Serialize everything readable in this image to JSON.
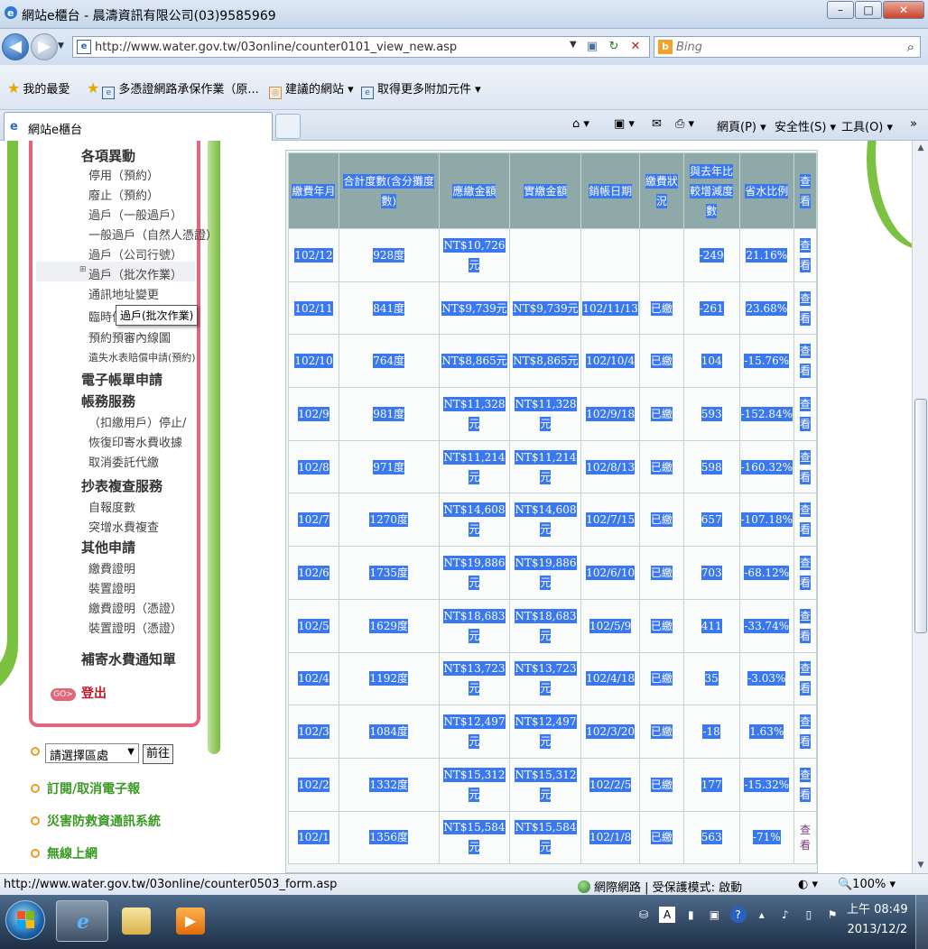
{
  "window": {
    "title": "網站e櫃台 - 晨濤資訊有限公司(03)9585969",
    "min": "–",
    "max": "□",
    "close": "✕"
  },
  "address": {
    "url": "http://www.water.gov.tw/03online/counter0101_view_new.asp",
    "back": "◀",
    "forward": "▶",
    "dropdown": "▼",
    "stop": "✕",
    "refresh": "↻",
    "compat": "▣",
    "search_placeholder": "Bing",
    "search_icon": "⌕",
    "bing_logo": "b"
  },
  "favorites": {
    "label": "我的最愛",
    "items": [
      "多憑證網路承保作業（原...",
      "建議的網站 ▾",
      "取得更多附加元件 ▾"
    ]
  },
  "tab": {
    "label": "網站e櫃台",
    "icon": "e"
  },
  "commands": {
    "home": "⌂ ▾",
    "feeds": "▣ ▾",
    "mail": "✉",
    "print": "⎙ ▾",
    "page": "網頁(P) ▾",
    "safety": "安全性(S) ▾",
    "tools": "工具(O) ▾",
    "more": "»"
  },
  "menu": {
    "sections": [
      {
        "head": "各項異動",
        "items": [
          "停用（預約）",
          "廢止（預約）",
          "過戶（一般過戶）",
          "一般過戶（自然人憑證）",
          "過戶（公司行號）",
          "過戶（批次作業）",
          "通訊地址變更",
          "臨時停",
          "預約預審內線圖",
          "遺失水表賠償申請(預約)"
        ]
      },
      {
        "head": "電子帳單申請",
        "items": []
      },
      {
        "head": "帳務服務",
        "items": [
          "（扣繳用戶）停止/",
          "恢復印寄水費收據",
          "取消委託代繳"
        ]
      },
      {
        "head": "抄表複查服務",
        "items": [
          "自報度數",
          "突增水費複查"
        ]
      },
      {
        "head": "其他申請",
        "items": [
          "繳費證明",
          "裝置證明",
          "繳費證明（憑證）",
          "裝置證明（憑證）"
        ]
      },
      {
        "head": "補寄水費通知單",
        "items": []
      }
    ],
    "logout_badge": "GO>",
    "logout": "登出",
    "bullet_marker": "⊞",
    "tooltip": "過戶(批次作業)"
  },
  "region": {
    "select_value": "請選擇區處",
    "go": "前往",
    "arrow": "▼"
  },
  "links": [
    "訂閱/取消電子報",
    "災害防救資通訊系統",
    "無線上網"
  ],
  "table": {
    "headers": [
      "繳費年月",
      "合計度數(含分攤度數)",
      "應繳金額",
      "實繳金額",
      "銷帳日期",
      "繳費狀況",
      "與去年比較增減度數",
      "省水比例",
      "查看"
    ],
    "rows": [
      [
        "102/12",
        "928度",
        "NT$10,726元",
        "",
        "",
        "",
        "-249",
        "21.16%",
        "查看"
      ],
      [
        "102/11",
        "841度",
        "NT$9,739元",
        "NT$9,739元",
        "102/11/13",
        "已繳",
        "-261",
        "23.68%",
        "查看"
      ],
      [
        "102/10",
        "764度",
        "NT$8,865元",
        "NT$8,865元",
        "102/10/4",
        "已繳",
        "104",
        "-15.76%",
        "查看"
      ],
      [
        "102/9",
        "981度",
        "NT$11,328元",
        "NT$11,328元",
        "102/9/18",
        "已繳",
        "593",
        "-152.84%",
        "查看"
      ],
      [
        "102/8",
        "971度",
        "NT$11,214元",
        "NT$11,214元",
        "102/8/13",
        "已繳",
        "598",
        "-160.32%",
        "查看"
      ],
      [
        "102/7",
        "1270度",
        "NT$14,608元",
        "NT$14,608元",
        "102/7/15",
        "已繳",
        "657",
        "-107.18%",
        "查看"
      ],
      [
        "102/6",
        "1735度",
        "NT$19,886元",
        "NT$19,886元",
        "102/6/10",
        "已繳",
        "703",
        "-68.12%",
        "查看"
      ],
      [
        "102/5",
        "1629度",
        "NT$18,683元",
        "NT$18,683元",
        "102/5/9",
        "已繳",
        "411",
        "-33.74%",
        "查看"
      ],
      [
        "102/4",
        "1192度",
        "NT$13,723元",
        "NT$13,723元",
        "102/4/18",
        "已繳",
        "35",
        "-3.03%",
        "查看"
      ],
      [
        "102/3",
        "1084度",
        "NT$12,497元",
        "NT$12,497元",
        "102/3/20",
        "已繳",
        "-18",
        "1.63%",
        "查看"
      ],
      [
        "102/2",
        "1332度",
        "NT$15,312元",
        "NT$15,312元",
        "102/2/5",
        "已繳",
        "177",
        "-15.32%",
        "查看"
      ],
      [
        "102/1",
        "1356度",
        "NT$15,584元",
        "NT$15,584元",
        "102/1/8",
        "已繳",
        "563",
        "-71%",
        "查看"
      ]
    ]
  },
  "status": {
    "url": "http://www.water.gov.tw/03online/counter0503_form.asp",
    "zone": "網際網路 | 受保護模式: 啟動",
    "zoom": "🔍100%  ▾",
    "zone_icon": "◐ ▾"
  },
  "taskbar": {
    "tray_icons": [
      "⛁",
      "A",
      "▮",
      "▣",
      "?",
      "▴",
      "♪",
      "▯",
      "⚑"
    ],
    "time": "上午 08:49",
    "date": "2013/12/2"
  }
}
